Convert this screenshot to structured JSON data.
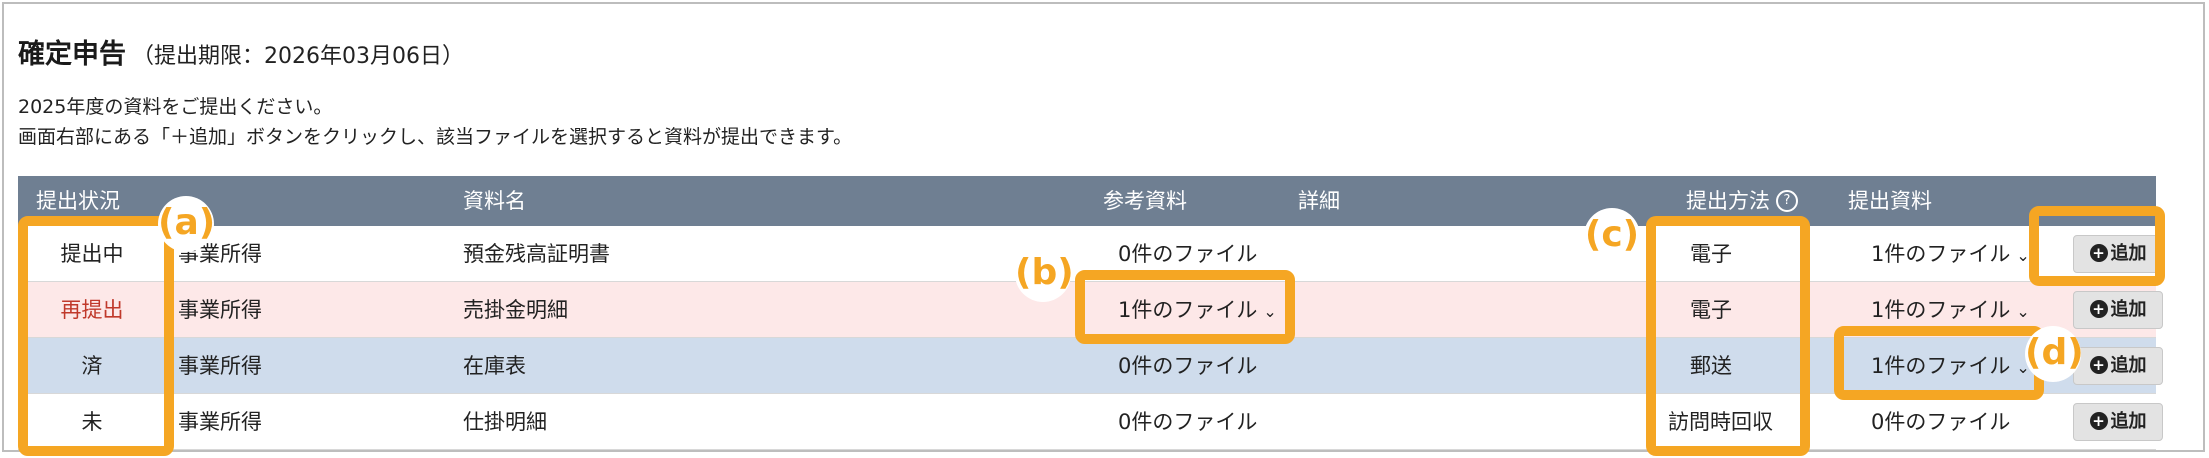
{
  "header": {
    "title": "確定申告",
    "deadline": "（提出期限：2026年03月06日）"
  },
  "instructions": {
    "line1": "2025年度の資料をご提出ください。",
    "line2": "画面右部にある「＋追加」ボタンをクリックし、該当ファイルを選択すると資料が提出できます。"
  },
  "table": {
    "headers": {
      "status": "提出状況",
      "name": "資料名",
      "reference": "参考資料",
      "detail": "詳細",
      "method": "提出方法",
      "submitted": "提出資料"
    },
    "help_icon_glyph": "?",
    "rows": [
      {
        "status": "提出中",
        "status_color": "#222222",
        "bg": "#ffffff",
        "category": "事業所得",
        "name": "預金残高証明書",
        "reference": "0件のファイル",
        "ref_has_dropdown": false,
        "method": "電子",
        "submitted": "1件のファイル",
        "sub_has_dropdown": true,
        "add_label": "追加"
      },
      {
        "status": "再提出",
        "status_color": "#c0392b",
        "bg": "#fde8e8",
        "category": "事業所得",
        "name": "売掛金明細",
        "reference": "1件のファイル",
        "ref_has_dropdown": true,
        "method": "電子",
        "submitted": "1件のファイル",
        "sub_has_dropdown": true,
        "add_label": "追加"
      },
      {
        "status": "済",
        "status_color": "#222222",
        "bg": "#cfdcec",
        "category": "事業所得",
        "name": "在庫表",
        "reference": "0件のファイル",
        "ref_has_dropdown": false,
        "method": "郵送",
        "submitted": "1件のファイル",
        "sub_has_dropdown": true,
        "add_label": "追加"
      },
      {
        "status": "未",
        "status_color": "#222222",
        "bg": "#ffffff",
        "category": "事業所得",
        "name": "仕掛明細",
        "reference": "0件のファイル",
        "ref_has_dropdown": false,
        "method": "訪問時回収",
        "submitted": "0件のファイル",
        "sub_has_dropdown": false,
        "add_label": "追加"
      }
    ]
  },
  "annotations": {
    "a": "(a)",
    "b": "(b)",
    "c": "(c)",
    "d": "(d)",
    "color": "#f5a623"
  },
  "icons": {
    "chevron": "chevron-down-icon",
    "plus": "plus-circle-icon",
    "help": "help-circle-icon"
  }
}
